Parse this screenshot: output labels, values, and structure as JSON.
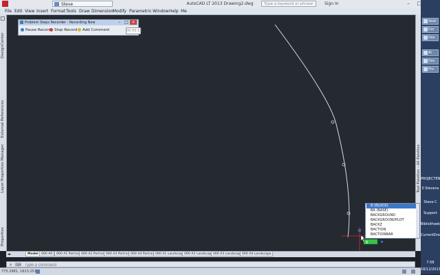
{
  "window": {
    "title": "AutoCAD LT 2013   Drawing2.dwg",
    "workspace": "Steve",
    "search_placeholder": "Type a keyword or phrase",
    "sign_in": "Sign In",
    "controls": [
      "–",
      "□",
      "×"
    ]
  },
  "menu": [
    "File",
    "Edit",
    "View",
    "Insert",
    "Format",
    "Tools",
    "Draw",
    "Dimension",
    "Modify",
    "Parametric",
    "Window",
    "Help",
    "Me"
  ],
  "left_panels": [
    "DesignCenter",
    "External References",
    "Layer Properties Manager",
    "Properties"
  ],
  "right_panel": "Tool Palettes - All Palettes",
  "recorder": {
    "title": "Problem Steps Recorder - Recording Now",
    "pause": "Pause Record",
    "stop": "Stop Record",
    "add_comment": "Add Comment",
    "time": "00:00:15"
  },
  "tabs": [
    "Model",
    "000 A0",
    "000 A1 Portrait",
    "000 A2 Portrait",
    "000 A3 Portrait",
    "000 A4 Portrait",
    "000 A1 Landscape",
    "000 A2 Landscape",
    "000 A3 Landscape",
    "000 A4 Landscape"
  ],
  "command_placeholder": "Type a command",
  "status": {
    "coords": "775.2981, 1613.2514"
  },
  "autocomplete": {
    "items": [
      "B (BLOCK)",
      "BA (BASE)",
      "BACKGROUND",
      "BACKGROUNDPLOT",
      "BACKZ",
      "BACTION",
      "BACTIONBAR"
    ],
    "selected_index": 0,
    "input_value": "B"
  },
  "taskbar": {
    "items": [
      "Seat",
      "Cor",
      "Des",
      "Al",
      "Des",
      "Pro"
    ],
    "labels": [
      "PROJECTEN",
      "0 Stevens",
      "Steve C",
      "Support",
      "Bibliotheek",
      "CurrentDraw",
      "7:58",
      "18/12/2013"
    ]
  },
  "colors": {
    "canvas": "#252a30",
    "curve": "#d8dde4",
    "grip_green": "#37c24a",
    "selection_blue": "#3d78c8",
    "crosshair_red": "#d22a2a"
  }
}
